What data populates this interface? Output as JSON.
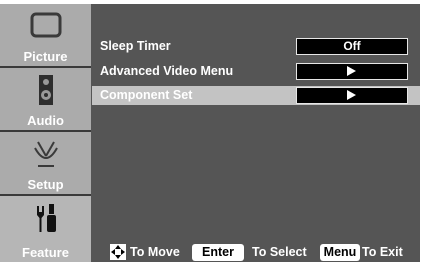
{
  "sidebar": {
    "items": [
      {
        "label": "Picture",
        "icon": "tv-screen-icon"
      },
      {
        "label": "Audio",
        "icon": "speaker-icon"
      },
      {
        "label": "Setup",
        "icon": "satellite-antenna-icon"
      },
      {
        "label": "Feature",
        "icon": "tools-icon"
      }
    ],
    "active_index": 3
  },
  "menu": {
    "items": [
      {
        "label": "Sleep Timer",
        "value": "Off",
        "type": "value"
      },
      {
        "label": "Advanced Video Menu",
        "value": "▶",
        "type": "submenu"
      },
      {
        "label": "Component Set",
        "value": "▶",
        "type": "submenu",
        "selected": true
      }
    ]
  },
  "footer": {
    "move_text": "To Move",
    "enter_key": "Enter",
    "select_text": "To Select",
    "menu_key": "Menu",
    "exit_text": "To Exit"
  },
  "colors": {
    "background": "#555555",
    "sidebar_item": "#ababab",
    "selected_row": "#c3c3c3",
    "value_box": "#000000"
  }
}
